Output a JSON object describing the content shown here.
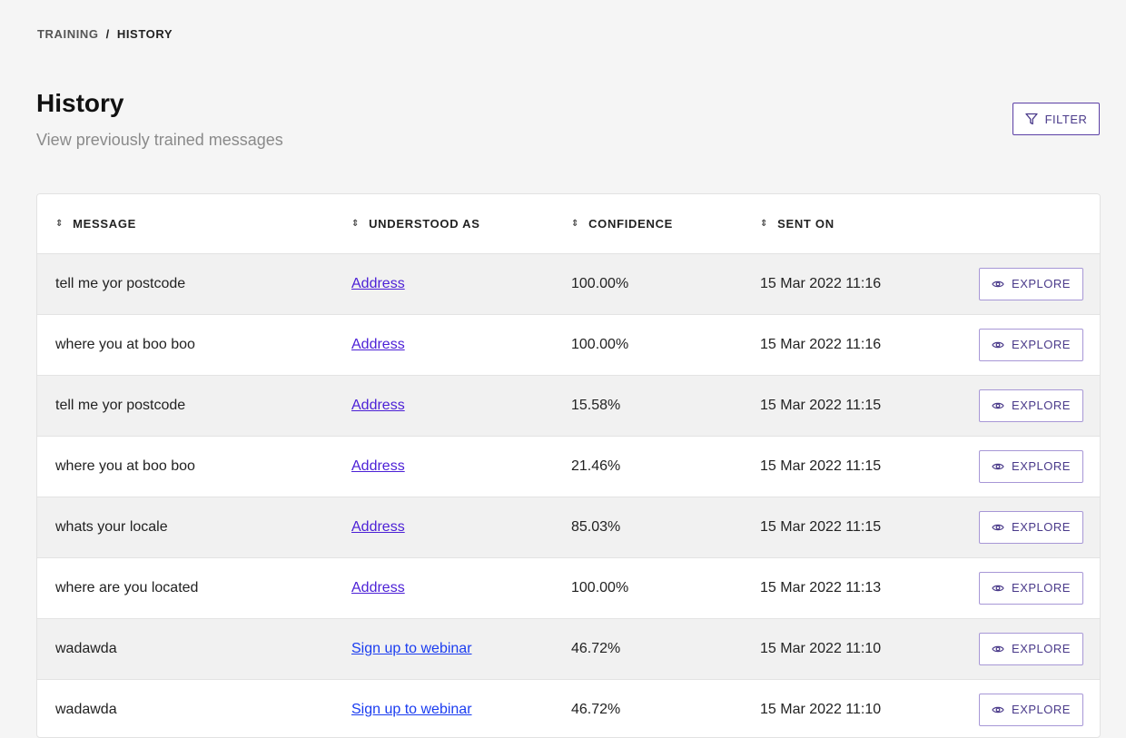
{
  "breadcrumb": {
    "first": "TRAINING",
    "separator": "/",
    "current": "HISTORY"
  },
  "header": {
    "title": "History",
    "subtitle": "View previously trained messages",
    "filter_label": "FILTER"
  },
  "table": {
    "columns": [
      "MESSAGE",
      "UNDERSTOOD AS",
      "CONFIDENCE",
      "SENT ON"
    ],
    "explore_label": "EXPLORE",
    "rows": [
      {
        "message": "tell me yor postcode",
        "understood_as": "Address",
        "confidence": "100.00%",
        "sent_on": "15 Mar 2022 11:16"
      },
      {
        "message": "where you at boo boo",
        "understood_as": "Address",
        "confidence": "100.00%",
        "sent_on": "15 Mar 2022 11:16"
      },
      {
        "message": "tell me yor postcode",
        "understood_as": "Address",
        "confidence": "15.58%",
        "sent_on": "15 Mar 2022 11:15"
      },
      {
        "message": "where you at boo boo",
        "understood_as": "Address",
        "confidence": "21.46%",
        "sent_on": "15 Mar 2022 11:15"
      },
      {
        "message": "whats your locale",
        "understood_as": "Address",
        "confidence": "85.03%",
        "sent_on": "15 Mar 2022 11:15"
      },
      {
        "message": "where are you located",
        "understood_as": "Address",
        "confidence": "100.00%",
        "sent_on": "15 Mar 2022 11:13"
      },
      {
        "message": "wadawda",
        "understood_as": "Sign up to webinar",
        "confidence": "46.72%",
        "sent_on": "15 Mar 2022 11:10"
      },
      {
        "message": "wadawda",
        "understood_as": "Sign up to webinar",
        "confidence": "46.72%",
        "sent_on": "15 Mar 2022 11:10"
      }
    ]
  }
}
